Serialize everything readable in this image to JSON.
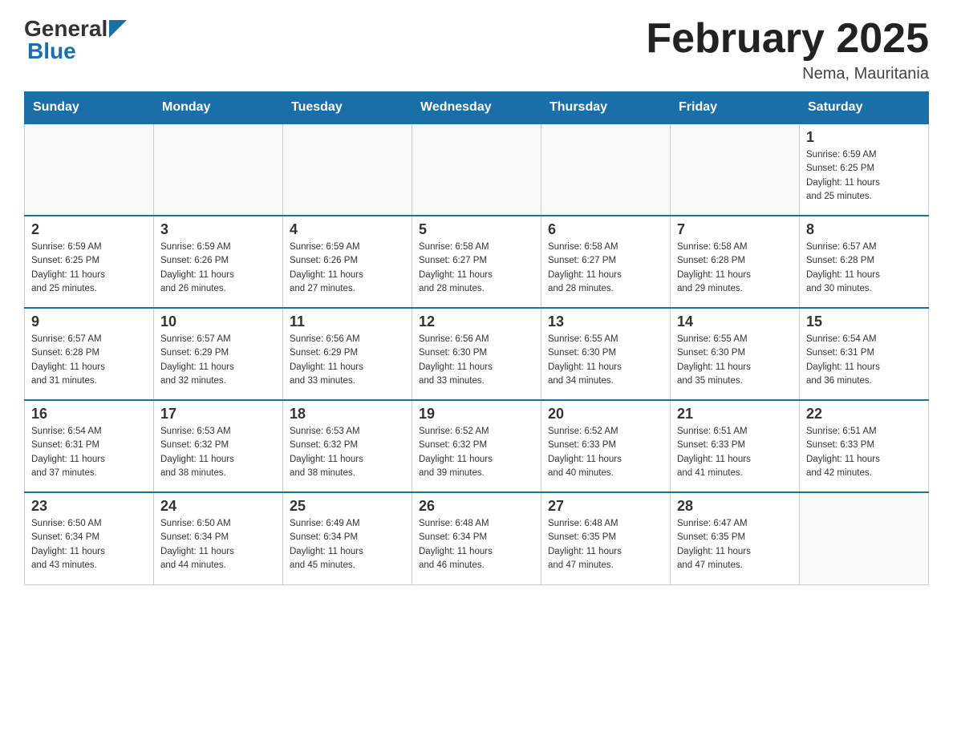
{
  "header": {
    "logo_general": "General",
    "logo_blue": "Blue",
    "month_title": "February 2025",
    "location": "Nema, Mauritania"
  },
  "weekdays": [
    "Sunday",
    "Monday",
    "Tuesday",
    "Wednesday",
    "Thursday",
    "Friday",
    "Saturday"
  ],
  "weeks": [
    [
      {
        "day": "",
        "info": ""
      },
      {
        "day": "",
        "info": ""
      },
      {
        "day": "",
        "info": ""
      },
      {
        "day": "",
        "info": ""
      },
      {
        "day": "",
        "info": ""
      },
      {
        "day": "",
        "info": ""
      },
      {
        "day": "1",
        "info": "Sunrise: 6:59 AM\nSunset: 6:25 PM\nDaylight: 11 hours\nand 25 minutes."
      }
    ],
    [
      {
        "day": "2",
        "info": "Sunrise: 6:59 AM\nSunset: 6:25 PM\nDaylight: 11 hours\nand 25 minutes."
      },
      {
        "day": "3",
        "info": "Sunrise: 6:59 AM\nSunset: 6:26 PM\nDaylight: 11 hours\nand 26 minutes."
      },
      {
        "day": "4",
        "info": "Sunrise: 6:59 AM\nSunset: 6:26 PM\nDaylight: 11 hours\nand 27 minutes."
      },
      {
        "day": "5",
        "info": "Sunrise: 6:58 AM\nSunset: 6:27 PM\nDaylight: 11 hours\nand 28 minutes."
      },
      {
        "day": "6",
        "info": "Sunrise: 6:58 AM\nSunset: 6:27 PM\nDaylight: 11 hours\nand 28 minutes."
      },
      {
        "day": "7",
        "info": "Sunrise: 6:58 AM\nSunset: 6:28 PM\nDaylight: 11 hours\nand 29 minutes."
      },
      {
        "day": "8",
        "info": "Sunrise: 6:57 AM\nSunset: 6:28 PM\nDaylight: 11 hours\nand 30 minutes."
      }
    ],
    [
      {
        "day": "9",
        "info": "Sunrise: 6:57 AM\nSunset: 6:28 PM\nDaylight: 11 hours\nand 31 minutes."
      },
      {
        "day": "10",
        "info": "Sunrise: 6:57 AM\nSunset: 6:29 PM\nDaylight: 11 hours\nand 32 minutes."
      },
      {
        "day": "11",
        "info": "Sunrise: 6:56 AM\nSunset: 6:29 PM\nDaylight: 11 hours\nand 33 minutes."
      },
      {
        "day": "12",
        "info": "Sunrise: 6:56 AM\nSunset: 6:30 PM\nDaylight: 11 hours\nand 33 minutes."
      },
      {
        "day": "13",
        "info": "Sunrise: 6:55 AM\nSunset: 6:30 PM\nDaylight: 11 hours\nand 34 minutes."
      },
      {
        "day": "14",
        "info": "Sunrise: 6:55 AM\nSunset: 6:30 PM\nDaylight: 11 hours\nand 35 minutes."
      },
      {
        "day": "15",
        "info": "Sunrise: 6:54 AM\nSunset: 6:31 PM\nDaylight: 11 hours\nand 36 minutes."
      }
    ],
    [
      {
        "day": "16",
        "info": "Sunrise: 6:54 AM\nSunset: 6:31 PM\nDaylight: 11 hours\nand 37 minutes."
      },
      {
        "day": "17",
        "info": "Sunrise: 6:53 AM\nSunset: 6:32 PM\nDaylight: 11 hours\nand 38 minutes."
      },
      {
        "day": "18",
        "info": "Sunrise: 6:53 AM\nSunset: 6:32 PM\nDaylight: 11 hours\nand 38 minutes."
      },
      {
        "day": "19",
        "info": "Sunrise: 6:52 AM\nSunset: 6:32 PM\nDaylight: 11 hours\nand 39 minutes."
      },
      {
        "day": "20",
        "info": "Sunrise: 6:52 AM\nSunset: 6:33 PM\nDaylight: 11 hours\nand 40 minutes."
      },
      {
        "day": "21",
        "info": "Sunrise: 6:51 AM\nSunset: 6:33 PM\nDaylight: 11 hours\nand 41 minutes."
      },
      {
        "day": "22",
        "info": "Sunrise: 6:51 AM\nSunset: 6:33 PM\nDaylight: 11 hours\nand 42 minutes."
      }
    ],
    [
      {
        "day": "23",
        "info": "Sunrise: 6:50 AM\nSunset: 6:34 PM\nDaylight: 11 hours\nand 43 minutes."
      },
      {
        "day": "24",
        "info": "Sunrise: 6:50 AM\nSunset: 6:34 PM\nDaylight: 11 hours\nand 44 minutes."
      },
      {
        "day": "25",
        "info": "Sunrise: 6:49 AM\nSunset: 6:34 PM\nDaylight: 11 hours\nand 45 minutes."
      },
      {
        "day": "26",
        "info": "Sunrise: 6:48 AM\nSunset: 6:34 PM\nDaylight: 11 hours\nand 46 minutes."
      },
      {
        "day": "27",
        "info": "Sunrise: 6:48 AM\nSunset: 6:35 PM\nDaylight: 11 hours\nand 47 minutes."
      },
      {
        "day": "28",
        "info": "Sunrise: 6:47 AM\nSunset: 6:35 PM\nDaylight: 11 hours\nand 47 minutes."
      },
      {
        "day": "",
        "info": ""
      }
    ]
  ]
}
